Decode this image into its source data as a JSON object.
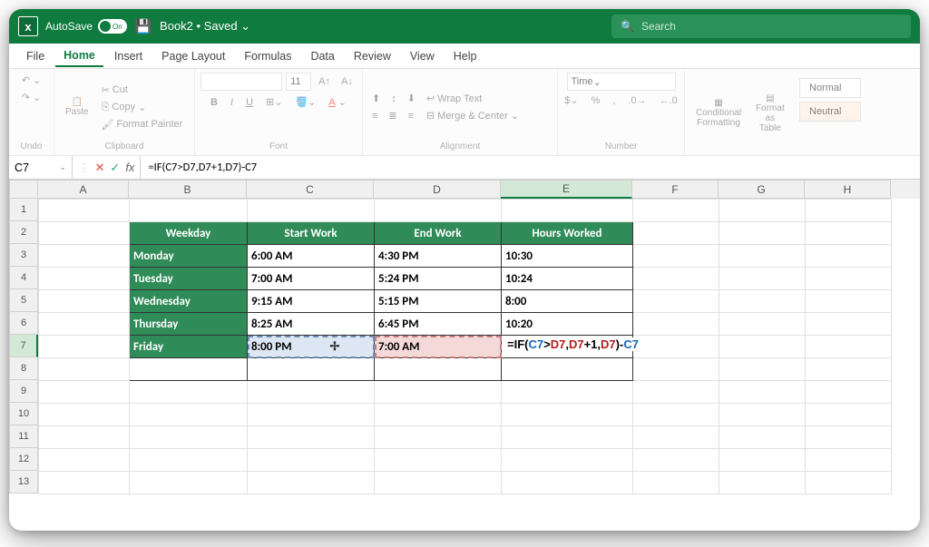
{
  "titlebar": {
    "autosave_label": "AutoSave",
    "autosave_state": "On",
    "filename": "Book2 • Saved ⌄",
    "search_placeholder": "Search"
  },
  "menu": {
    "items": [
      "File",
      "Home",
      "Insert",
      "Page Layout",
      "Formulas",
      "Data",
      "Review",
      "View",
      "Help"
    ],
    "active": "Home"
  },
  "ribbon": {
    "undo_label": "Undo",
    "clipboard_label": "Clipboard",
    "paste": "Paste",
    "cut": "Cut",
    "copy": "Copy",
    "format_painter": "Format Painter",
    "font_label": "Font",
    "font_name": "",
    "font_size": "11",
    "alignment_label": "Alignment",
    "wrap": "Wrap Text",
    "merge": "Merge & Center",
    "number_label": "Number",
    "number_format": "Time",
    "cond_fmt": "Conditional Formatting",
    "fmt_table": "Format as Table",
    "style_normal": "Normal",
    "style_neutral": "Neutral"
  },
  "formulabar": {
    "namebox": "C7",
    "formula": "=IF(C7>D7,D7+1,D7)-C7"
  },
  "columns": [
    "A",
    "B",
    "C",
    "D",
    "E",
    "F",
    "G",
    "H"
  ],
  "selected_column": "E",
  "row_count": 13,
  "selected_row": 7,
  "table": {
    "headers": [
      "Weekday",
      "Start Work",
      "End Work",
      "Hours Worked"
    ],
    "rows": [
      {
        "day": "Monday",
        "start": "6:00 AM",
        "end": "4:30 PM",
        "hours": "10:30"
      },
      {
        "day": "Tuesday",
        "start": "7:00 AM",
        "end": "5:24 PM",
        "hours": "10:24"
      },
      {
        "day": "Wednesday",
        "start": "9:15 AM",
        "end": "5:15 PM",
        "hours": "8:00"
      },
      {
        "day": "Thursday",
        "start": "8:25 AM",
        "end": "6:45 PM",
        "hours": "10:20"
      },
      {
        "day": "Friday",
        "start": "8:00 PM",
        "end": "7:00 AM",
        "hours": ""
      }
    ]
  },
  "formula_display": {
    "prefix": "=IF(",
    "ref1": "C7",
    "op": ">",
    "ref2a": "D7",
    "c1": ",",
    "ref2b": "D7",
    "plus": "+1",
    "c2": ",",
    "ref2c": "D7",
    "close": ")-",
    "ref1b": "C7"
  }
}
